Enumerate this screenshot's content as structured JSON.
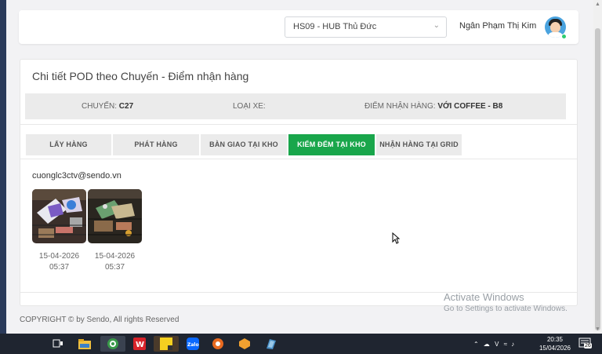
{
  "header": {
    "hub_select_value": "HS09 - HUB Thủ Đức",
    "user_name": "Ngân Phạm Thị Kim"
  },
  "page": {
    "title": "Chi tiết POD theo Chuyến - Điểm nhận hàng"
  },
  "info": {
    "trip_label": "CHUYẾN:",
    "trip_value": "C27",
    "vehicle_label": "LOẠI XE:",
    "vehicle_value": "",
    "pickup_label": "ĐIỂM NHẬN HÀNG:",
    "pickup_value": "VỚI COFFEE - B8"
  },
  "tabs": [
    {
      "label": "LẤY HÀNG",
      "active": false
    },
    {
      "label": "PHÁT HÀNG",
      "active": false
    },
    {
      "label": "BÀN GIAO TẠI KHO",
      "active": false
    },
    {
      "label": "KIỂM ĐẾM TẠI KHO",
      "active": true
    },
    {
      "label": "NHẬN HÀNG TẠI GRID",
      "active": false
    }
  ],
  "content": {
    "email": "cuonglc3ctv@sendo.vn",
    "photos": [
      {
        "date": "15-04-2026",
        "time": "05:37"
      },
      {
        "date": "15-04-2026",
        "time": "05:37"
      }
    ]
  },
  "footer": {
    "copyright": "COPYRIGHT © by Sendo, All rights Reserved"
  },
  "watermark": {
    "line1": "Activate Windows",
    "line2": "Go to Settings to activate Windows."
  },
  "taskbar": {
    "time": "20:35",
    "date": "15/04/2026",
    "lang": "Ｖ",
    "notif_count": "26"
  },
  "colors": {
    "active_tab": "#19a64b",
    "status_online": "#2ecc71"
  }
}
